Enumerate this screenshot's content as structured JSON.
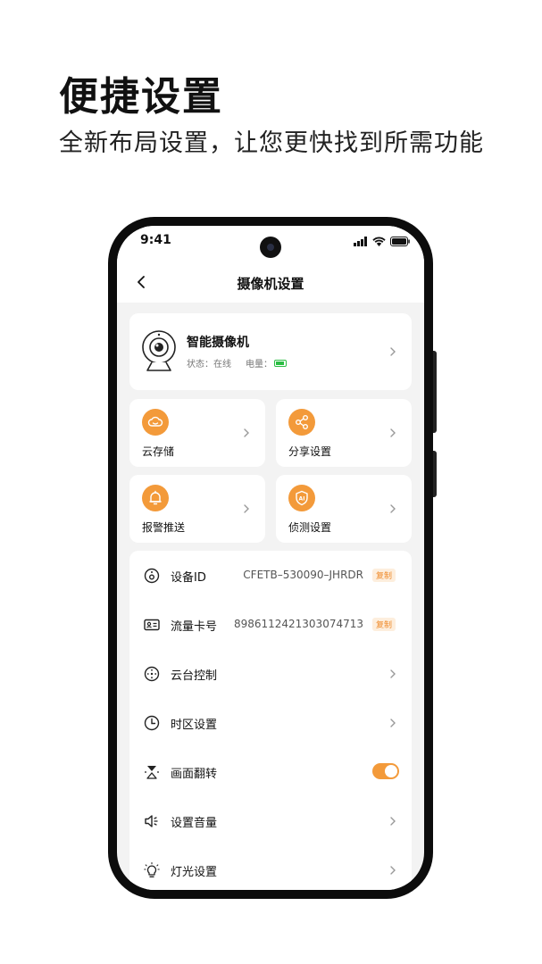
{
  "promo": {
    "title": "便捷设置",
    "subtitle": "全新布局设置，让您更快找到所需功能"
  },
  "status_bar": {
    "time": "9:41"
  },
  "nav": {
    "title": "摄像机设置"
  },
  "device": {
    "name": "智能摄像机",
    "status_label": "状态：在线",
    "battery_label": "电量："
  },
  "tiles": [
    {
      "label": "云存储",
      "icon": "cloud-icon"
    },
    {
      "label": "分享设置",
      "icon": "share-icon"
    },
    {
      "label": "报警推送",
      "icon": "bell-icon"
    },
    {
      "label": "侦测设置",
      "icon": "ai-shield-icon"
    }
  ],
  "settings": {
    "device_id": {
      "label": "设备ID",
      "value": "CFETB–530090–JHRDR",
      "copy": "复制"
    },
    "sim_card": {
      "label": "流量卡号",
      "value": "89861124213030747​13",
      "copy": "复制"
    },
    "ptz": {
      "label": "云台控制"
    },
    "timezone": {
      "label": "时区设置"
    },
    "flip": {
      "label": "画面翻转",
      "enabled": true
    },
    "volume": {
      "label": "设置音量"
    },
    "light": {
      "label": "灯光设置"
    }
  },
  "colors": {
    "accent": "#f39a3a",
    "battery": "#2bbd43",
    "background": "#f3f3f3"
  }
}
